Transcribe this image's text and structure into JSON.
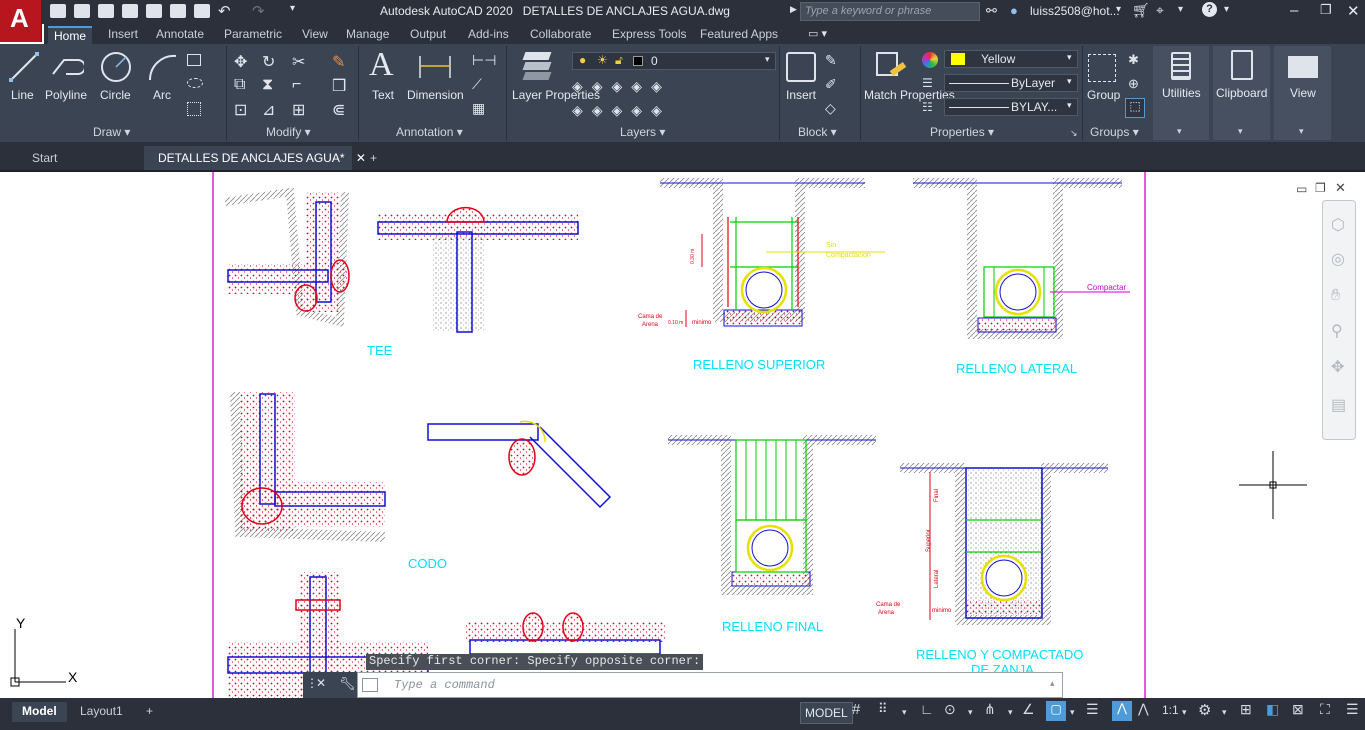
{
  "app": {
    "logo_letter": "A",
    "title": "Autodesk AutoCAD 2020",
    "filename": "DETALLES DE ANCLAJES AGUA.dwg",
    "search_placeholder": "Type a keyword or phrase",
    "user": "luiss2508@hot..."
  },
  "ribbon_tabs": [
    "Home",
    "Insert",
    "Annotate",
    "Parametric",
    "View",
    "Manage",
    "Output",
    "Add-ins",
    "Collaborate",
    "Express Tools",
    "Featured Apps"
  ],
  "ribbon": {
    "draw": {
      "label": "Draw",
      "tools": [
        "Line",
        "Polyline",
        "Circle",
        "Arc"
      ]
    },
    "modify": {
      "label": "Modify"
    },
    "annotation": {
      "label": "Annotation",
      "tools": [
        "Text",
        "Dimension"
      ]
    },
    "layers": {
      "label": "Layers",
      "layer_properties": "Layer Properties",
      "current_layer": "0"
    },
    "block": {
      "label": "Block",
      "insert": "Insert"
    },
    "properties": {
      "label": "Properties",
      "match_properties": "Match Properties",
      "color": "Yellow",
      "linetype": "ByLayer",
      "lineweight": "BYLAY..."
    },
    "groups": {
      "label": "Groups",
      "group": "Group"
    },
    "utilities": "Utilities",
    "clipboard": "Clipboard",
    "view": "View"
  },
  "doc_tabs": {
    "start": "Start",
    "active": "DETALLES DE ANCLAJES AGUA*",
    "close": "✕",
    "add": "+"
  },
  "drawing": {
    "labels": {
      "tee": "TEE",
      "codo": "CODO",
      "relleno_superior": "RELLENO SUPERIOR",
      "relleno_lateral": "RELLENO LATERAL",
      "relleno_final": "RELLENO FINAL",
      "relleno_compactado_1": "RELLENO Y COMPACTADO",
      "relleno_compactado_2": "DE ZANJA"
    },
    "annotations": {
      "sin_compactacion_1": "Sin",
      "sin_compactacion_2": "Compactacion",
      "compactar": "Compactar",
      "cama_arena_1": "Cama de",
      "cama_arena_2": "Arena",
      "minimo": "minimo",
      "dim_030": "0.30 m",
      "dim_010": "0.10 m",
      "final": "Final",
      "superior": "Superior",
      "lateral": "Lateral"
    },
    "colors": {
      "cyan": "#00e0ff",
      "red": "#e0001a",
      "green": "#00d000",
      "yellow": "#e8e000",
      "blue": "#1010d0",
      "magenta": "#d000d0",
      "hatch": "#888888"
    }
  },
  "command": {
    "history": "Specify first corner: Specify opposite corner:",
    "placeholder": "Type a command"
  },
  "status": {
    "layout_tabs": [
      "Model",
      "Layout1"
    ],
    "add": "+",
    "model": "MODEL",
    "scale": "1:1"
  },
  "ucs": {
    "x": "X",
    "y": "Y"
  }
}
